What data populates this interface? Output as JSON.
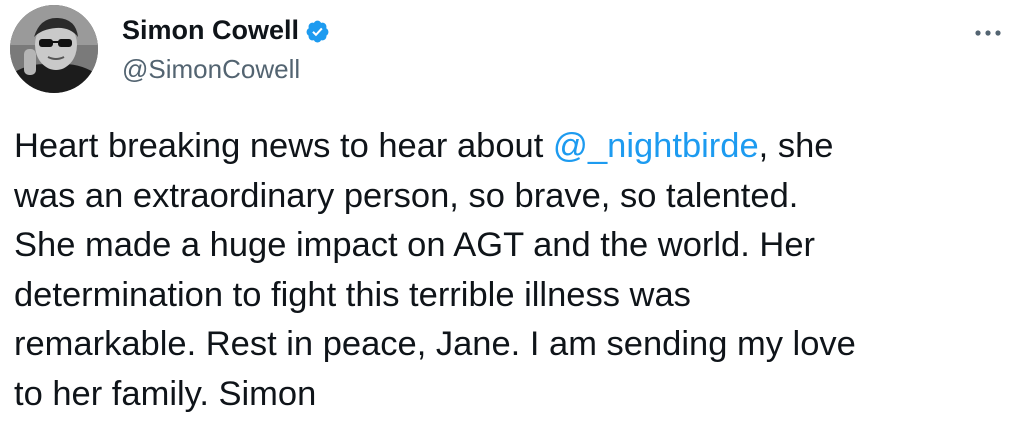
{
  "author": {
    "display_name": "Simon Cowell",
    "handle": "@SimonCowell",
    "verified": true,
    "verified_color": "#1d9bf0"
  },
  "menu": {
    "icon": "more-horizontal-icon"
  },
  "tweet": {
    "lines": [
      {
        "before": "Heart breaking news to hear about ",
        "mention": "@_nightbirde",
        "after": ", she"
      },
      {
        "text": "was an extraordinary person, so brave, so talented."
      },
      {
        "text": "She made a huge impact on AGT and the world. Her"
      },
      {
        "text": "determination to fight this terrible illness was"
      },
      {
        "text": "remarkable. Rest in peace, Jane. I am sending my love"
      },
      {
        "text": "to her family. Simon"
      }
    ],
    "mention_color": "#1d9bf0",
    "text_color": "#0f1419"
  }
}
